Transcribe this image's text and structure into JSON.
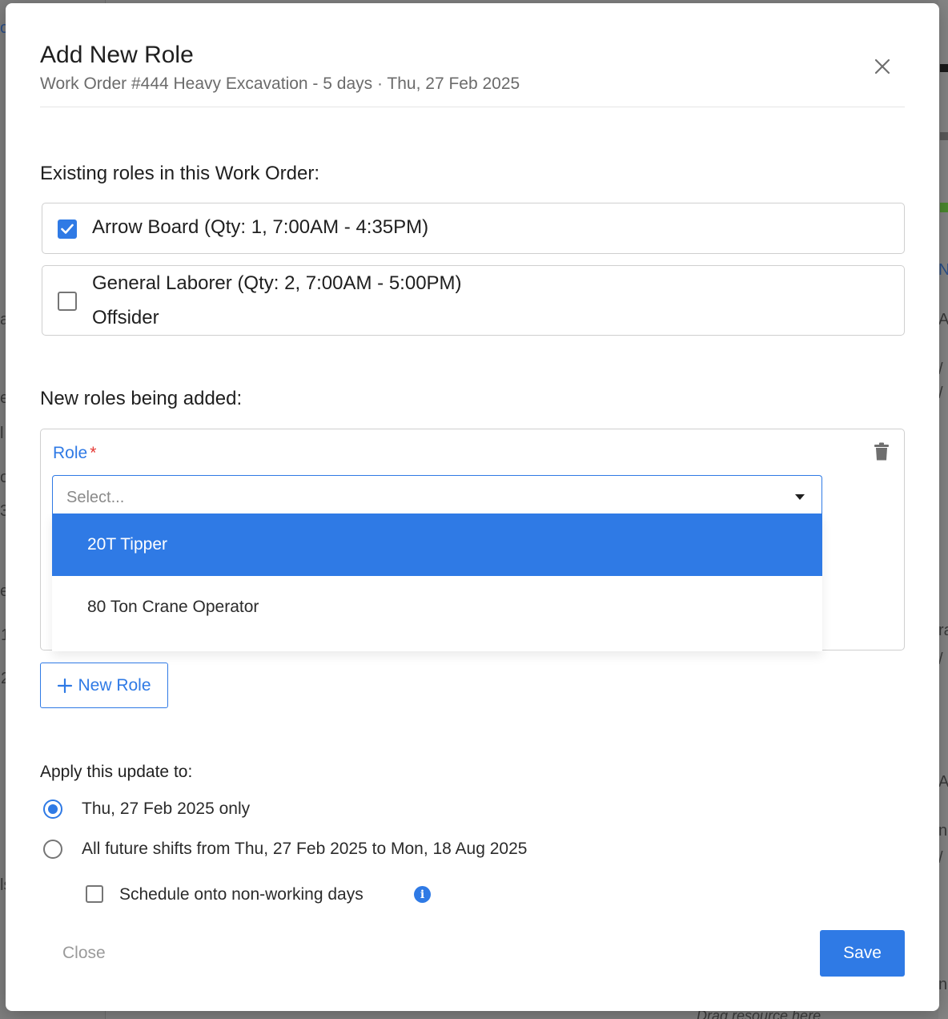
{
  "background": {
    "left_fragments": [
      "o",
      "a",
      "e",
      "l",
      "o",
      "3",
      "e",
      "1",
      "2",
      "ls"
    ],
    "right_fragments": [
      "N",
      "A",
      "/",
      "/",
      "ra",
      "/",
      "A",
      "n",
      "/",
      "n"
    ],
    "bottom_hint": "Drag resource here"
  },
  "modal": {
    "title": "Add New Role",
    "subtitle": "Work Order #444 Heavy Excavation - 5 days · Thu, 27 Feb 2025"
  },
  "existing": {
    "heading": "Existing roles in this Work Order:",
    "roles": [
      {
        "line1": "Arrow Board (Qty: 1, 7:00AM - 4:35PM)",
        "checked": true
      },
      {
        "line1": "General Laborer (Qty: 2, 7:00AM - 5:00PM)",
        "line2": "Offsider",
        "checked": false
      }
    ]
  },
  "new_roles": {
    "heading": "New roles being added:",
    "role_label": "Role",
    "required_mark": "*",
    "select_placeholder": "Select...",
    "options": [
      "20T Tipper",
      "80 Ton Crane Operator"
    ],
    "highlighted_option": "20T Tipper",
    "add_button": "New Role"
  },
  "apply": {
    "heading": "Apply this update to:",
    "options": [
      {
        "label": "Thu, 27 Feb 2025 only",
        "selected": true
      },
      {
        "label": "All future shifts from Thu, 27 Feb 2025 to Mon, 18 Aug 2025",
        "selected": false
      }
    ],
    "schedule_nonworking": {
      "label": "Schedule onto non-working days",
      "checked": false
    }
  },
  "footer": {
    "close_label": "Close",
    "save_label": "Save"
  },
  "colors": {
    "accent": "#2f7ae5",
    "required": "#e53935",
    "overlay": "#808080"
  }
}
